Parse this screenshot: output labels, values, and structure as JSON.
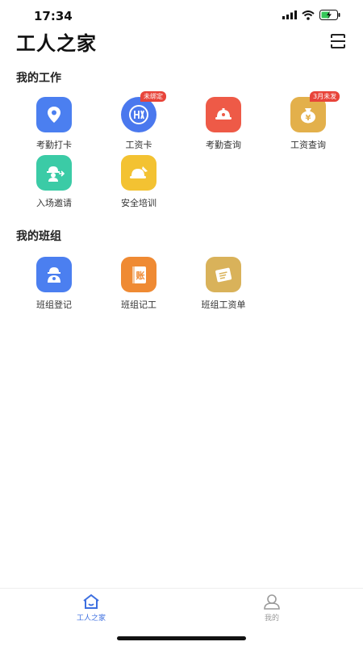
{
  "status_bar": {
    "time": "17:34"
  },
  "header": {
    "title": "工人之家"
  },
  "sections": {
    "work": {
      "title": "我的工作",
      "items": [
        {
          "label": "考勤打卡",
          "icon": "location-pin-icon",
          "color": "#4b7ff0"
        },
        {
          "label": "工资卡",
          "icon": "bank-card-icon",
          "color": "#4a78ee",
          "badge": "未绑定"
        },
        {
          "label": "考勤查询",
          "icon": "helmet-search-icon",
          "color": "#ee5a47"
        },
        {
          "label": "工资查询",
          "icon": "money-bag-icon",
          "color": "#e3b04b",
          "badge": "3月未发"
        },
        {
          "label": "入场邀请",
          "icon": "worker-invite-icon",
          "color": "#3bcba6"
        },
        {
          "label": "安全培训",
          "icon": "safety-helmet-icon",
          "color": "#f3c232"
        }
      ]
    },
    "team": {
      "title": "我的班组",
      "items": [
        {
          "label": "班组登记",
          "icon": "team-register-icon",
          "color": "#4b7ff0"
        },
        {
          "label": "班组记工",
          "icon": "ledger-book-icon",
          "color": "#ef8a33",
          "glyph": "账"
        },
        {
          "label": "班组工资单",
          "icon": "payroll-sheet-icon",
          "color": "#d9b25a"
        }
      ]
    }
  },
  "tabbar": {
    "home": {
      "label": "工人之家",
      "active_color": "#3d6fe0"
    },
    "mine": {
      "label": "我的",
      "inactive_color": "#9a9a9a"
    }
  }
}
